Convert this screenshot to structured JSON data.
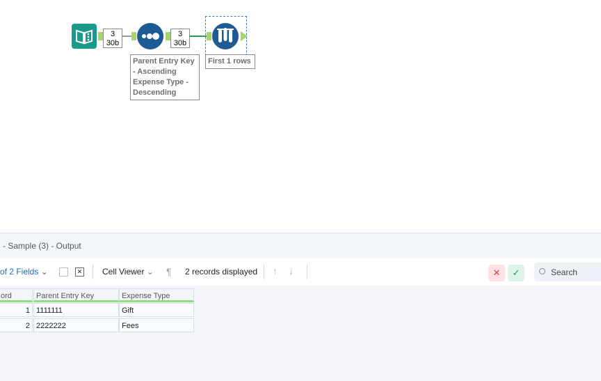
{
  "workflow": {
    "input_tool": {
      "icon": "book-input-icon"
    },
    "conn1": {
      "records": "3",
      "size": "30b"
    },
    "sort_tool": {
      "icon": "sort-icon",
      "annotation": [
        "Parent Entry Key",
        "- Ascending",
        "Expense Type -",
        "Descending"
      ]
    },
    "conn2": {
      "records": "3",
      "size": "30b"
    },
    "sample_tool": {
      "icon": "sample-tubes-icon",
      "annotation": "First 1 rows"
    }
  },
  "results": {
    "title": "- Sample (3) - Output",
    "fields_label": "of 2 Fields",
    "cell_viewer": "Cell Viewer",
    "records_displayed": "2 records displayed",
    "search_placeholder": "Search",
    "columns": [
      "ord",
      "Parent Entry Key",
      "Expense Type"
    ],
    "rows": [
      [
        "1",
        "1111111",
        "Gift"
      ],
      [
        "2",
        "2222222",
        "Fees"
      ]
    ]
  },
  "colors": {
    "accent": "#1e5b94",
    "anchor": "#a6d46a",
    "input": "#1a9a8a"
  }
}
